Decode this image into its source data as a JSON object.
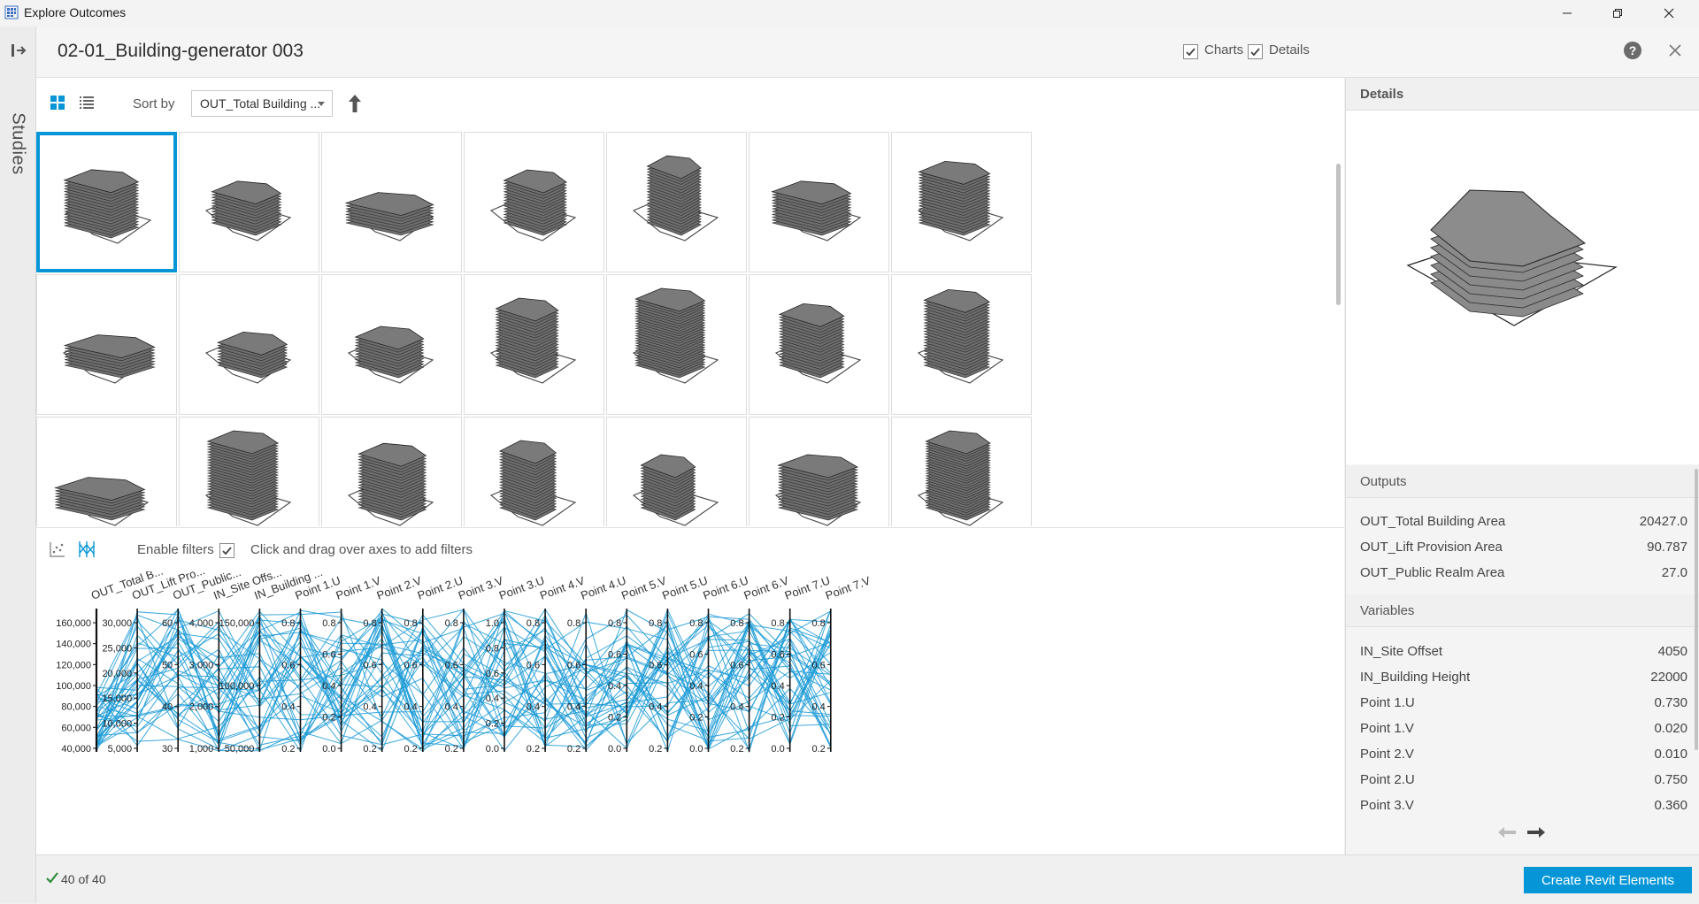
{
  "window": {
    "title": "Explore Outcomes",
    "minimize_icon": "minimize-icon",
    "restore_icon": "restore-icon",
    "close_icon": "close-icon"
  },
  "sidebar": {
    "label": "Studies",
    "exit_icon": "exit-panel-icon"
  },
  "header": {
    "study_title": "02-01_Building-generator 003",
    "charts_label": "Charts",
    "charts_checked": true,
    "details_label": "Details",
    "details_checked": true,
    "help_glyph": "?"
  },
  "toolbar": {
    "grid_view_icon": "grid-view-icon",
    "list_view_icon": "list-view-icon",
    "sort_by_label": "Sort by",
    "sort_value": "OUT_Total Building ...",
    "sort_direction_icon": "arrow-up-icon"
  },
  "gallery": {
    "rows_visible": 3,
    "columns": 7,
    "selected_index": 0
  },
  "filters": {
    "scatter_icon": "scatter-plot-icon",
    "parallel_icon": "parallel-coordinates-icon",
    "enable_label": "Enable filters",
    "enabled": true,
    "hint": "Click and drag over axes to add filters"
  },
  "chart_data": {
    "type": "parallel-coordinates",
    "axes": [
      {
        "label": "OUT_Total B...",
        "ticks": [
          "160,000",
          "140,000",
          "120,000",
          "100,000",
          "80,000",
          "60,000",
          "40,000"
        ]
      },
      {
        "label": "OUT_Lift Pro...",
        "ticks": [
          "30,000",
          "25,000",
          "20,000",
          "15,000",
          "10,000",
          "5,000"
        ]
      },
      {
        "label": "OUT_Public...",
        "ticks": [
          "60",
          "50",
          "40",
          "30"
        ]
      },
      {
        "label": "IN_Site Offs...",
        "ticks": [
          "4,000",
          "3,000",
          "2,000",
          "1,000"
        ]
      },
      {
        "label": "IN_Building ...",
        "ticks": [
          "150,000",
          "100,000",
          "50,000"
        ]
      },
      {
        "label": "Point 1.U",
        "ticks": [
          "0.8",
          "0.6",
          "0.4",
          "0.2"
        ]
      },
      {
        "label": "Point 1.V",
        "ticks": [
          "0.8",
          "0.6",
          "0.4",
          "0.2",
          "0.0"
        ]
      },
      {
        "label": "Point 2.V",
        "ticks": [
          "0.8",
          "0.6",
          "0.4",
          "0.2"
        ]
      },
      {
        "label": "Point 2.U",
        "ticks": [
          "0.8",
          "0.6",
          "0.4",
          "0.2"
        ]
      },
      {
        "label": "Point 3.V",
        "ticks": [
          "0.8",
          "0.6",
          "0.4",
          "0.2"
        ]
      },
      {
        "label": "Point 3.U",
        "ticks": [
          "1.0",
          "0.8",
          "0.6",
          "0.4",
          "0.2",
          "0.0"
        ]
      },
      {
        "label": "Point 4.V",
        "ticks": [
          "0.8",
          "0.6",
          "0.4",
          "0.2"
        ]
      },
      {
        "label": "Point 4.U",
        "ticks": [
          "0.8",
          "0.6",
          "0.4",
          "0.2"
        ]
      },
      {
        "label": "Point 5.V",
        "ticks": [
          "0.8",
          "0.6",
          "0.4",
          "0.2",
          "0.0"
        ]
      },
      {
        "label": "Point 5.U",
        "ticks": [
          "0.8",
          "0.6",
          "0.4",
          "0.2"
        ]
      },
      {
        "label": "Point 6.U",
        "ticks": [
          "0.8",
          "0.6",
          "0.4",
          "0.2",
          "0.0"
        ]
      },
      {
        "label": "Point 6.V",
        "ticks": [
          "0.8",
          "0.6",
          "0.4",
          "0.2"
        ]
      },
      {
        "label": "Point 7.U",
        "ticks": [
          "0.8",
          "0.6",
          "0.4",
          "0.2",
          "0.0"
        ]
      },
      {
        "label": "Point 7.V",
        "ticks": [
          "0.8",
          "0.6",
          "0.4",
          "0.2"
        ]
      }
    ],
    "line_count": 40,
    "line_color": "#1a9ad6"
  },
  "details": {
    "title": "Details",
    "outputs_label": "Outputs",
    "outputs": [
      {
        "name": "OUT_Total Building Area",
        "value": "20427.0"
      },
      {
        "name": "OUT_Lift Provision Area",
        "value": "90.787"
      },
      {
        "name": "OUT_Public Realm Area",
        "value": "27.0"
      }
    ],
    "variables_label": "Variables",
    "variables": [
      {
        "name": "IN_Site Offset",
        "value": "4050"
      },
      {
        "name": "IN_Building Height",
        "value": "22000"
      },
      {
        "name": "Point 1.U",
        "value": "0.730"
      },
      {
        "name": "Point 1.V",
        "value": "0.020"
      },
      {
        "name": "Point 2.V",
        "value": "0.010"
      },
      {
        "name": "Point 2.U",
        "value": "0.750"
      },
      {
        "name": "Point 3.V",
        "value": "0.360"
      }
    ],
    "prev_icon": "arrow-left-icon",
    "next_icon": "arrow-right-icon"
  },
  "status": {
    "check_icon": "check-icon",
    "count_text": "40 of 40",
    "create_button": "Create Revit Elements"
  },
  "colors": {
    "accent": "#0696d7",
    "line": "#1a9ad6",
    "massing": "#6e6e6e"
  }
}
